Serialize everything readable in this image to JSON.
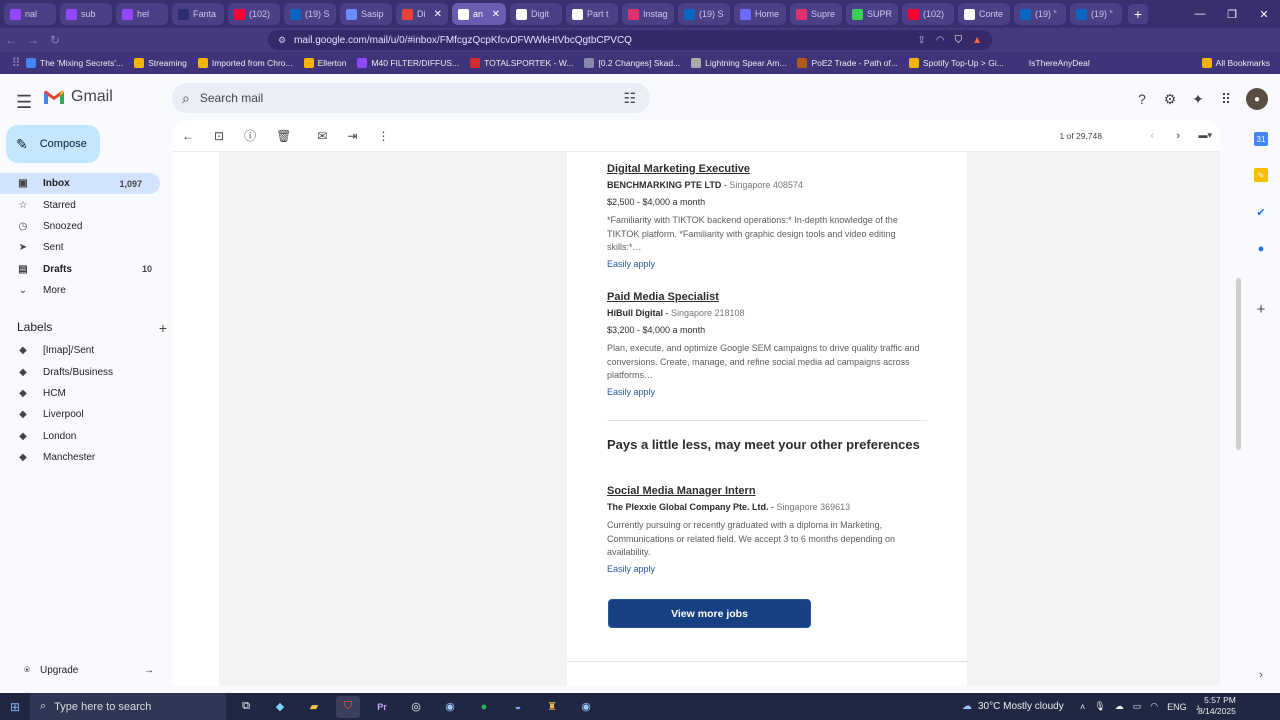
{
  "browser": {
    "tabs": [
      {
        "label": "nal",
        "icon": "twitch-icon",
        "color": "#9146ff"
      },
      {
        "label": "sub",
        "icon": "twitch-icon",
        "color": "#9146ff"
      },
      {
        "label": "hel",
        "icon": "twitch-icon",
        "color": "#9146ff"
      },
      {
        "label": "Fanta",
        "icon": "eye-icon",
        "color": "#2b2b6e"
      },
      {
        "label": "(102)",
        "icon": "youtube-icon",
        "color": "#ff0033"
      },
      {
        "label": "(19) S",
        "icon": "linkedin-icon",
        "color": "#0a66c2"
      },
      {
        "label": "Sasip",
        "icon": "loading-icon",
        "color": "#6a8cff"
      },
      {
        "label": "Di",
        "icon": "gmail-icon",
        "color": "#ea4335"
      },
      {
        "label": "an",
        "icon": "info-icon",
        "color": "#ffffff"
      },
      {
        "label": "Digit",
        "icon": "info-icon",
        "color": "#ffffff"
      },
      {
        "label": "Part t",
        "icon": "info-icon",
        "color": "#ffffff"
      },
      {
        "label": "Instag",
        "icon": "instagram-icon",
        "color": "#e1306c"
      },
      {
        "label": "(19) S",
        "icon": "linkedin-icon",
        "color": "#0a66c2"
      },
      {
        "label": "Home",
        "icon": "doc-icon",
        "color": "#6a6aff"
      },
      {
        "label": "Supre",
        "icon": "instagram-icon",
        "color": "#e1306c"
      },
      {
        "label": "SUPR",
        "icon": "star-icon",
        "color": "#3ccf5a"
      },
      {
        "label": "(102)",
        "icon": "youtube-icon",
        "color": "#ff0033"
      },
      {
        "label": "Conte",
        "icon": "circle-icon",
        "color": "#ffffff"
      },
      {
        "label": "(19) \"",
        "icon": "linkedin-icon",
        "color": "#0a66c2"
      },
      {
        "label": "(19) \"",
        "icon": "linkedin-icon",
        "color": "#0a66c2"
      }
    ],
    "url": "mail.google.com/mail/u/0/#inbox/FMfcgzQcpKfcvDFWWkHtVbcQgtbCPVCQ",
    "bookmarks": [
      {
        "label": "The 'Mixing Secrets'...",
        "color": "#4285f4"
      },
      {
        "label": "Streaming",
        "color": "#f4b400"
      },
      {
        "label": "Imported from Chro...",
        "color": "#f4b400"
      },
      {
        "label": "Ellerton",
        "color": "#f4b400"
      },
      {
        "label": "M40 FILTER/DIFFUS...",
        "color": "#9146ff"
      },
      {
        "label": "TOTALSPORTEK - W...",
        "color": "#d62b2b"
      },
      {
        "label": "[0.2 Changes] Skad...",
        "color": "#8888aa"
      },
      {
        "label": "Lightning Spear Am...",
        "color": "#aaaaaa"
      },
      {
        "label": "PoE2 Trade - Path of...",
        "color": "#b05a1a"
      },
      {
        "label": "Spotify Top-Up > Gi...",
        "color": "#f4b400"
      },
      {
        "label": "IsThereAnyDeal",
        "color": "#3f337a"
      }
    ],
    "all_bookmarks": "All Bookmarks"
  },
  "gmail": {
    "logo_text": "Gmail",
    "search_placeholder": "Search mail",
    "compose": "Compose",
    "nav": [
      {
        "label": "Inbox",
        "count": "1,097",
        "icon": "inbox-icon",
        "selected": true
      },
      {
        "label": "Starred",
        "count": "",
        "icon": "star-icon"
      },
      {
        "label": "Snoozed",
        "count": "",
        "icon": "clock-icon"
      },
      {
        "label": "Sent",
        "count": "",
        "icon": "send-icon"
      },
      {
        "label": "Drafts",
        "count": "10",
        "icon": "draft-icon",
        "bold": true
      },
      {
        "label": "More",
        "count": "",
        "icon": "chevron-down-icon"
      }
    ],
    "labels_title": "Labels",
    "labels": [
      "[Imap]/Sent",
      "Drafts/Business",
      "HCM",
      "Liverpool",
      "London",
      "Manchester"
    ],
    "upgrade": "Upgrade",
    "pagination": "1 of 29,748"
  },
  "email": {
    "jobs_top": [
      {
        "title": "Digital Marketing Executive",
        "company": "BENCHMARKING PTE LTD",
        "location": "Singapore 408574",
        "salary": "$2,500 - $4,000 a month",
        "desc": "*Familiarity with TIKTOK backend operations:* In-depth knowledge of the TIKTOK platform. *Familiarity with graphic design tools and video editing skills:*…",
        "apply": "Easily apply"
      },
      {
        "title": "Paid Media Specialist",
        "company": "HiBull Digital",
        "location": "Singapore 218108",
        "salary": "$3,200 - $4,000 a month",
        "desc": "Plan, execute, and optimize Google SEM campaigns to drive quality traffic and conversions. Create, manage, and refine social media ad campaigns across platforms…",
        "apply": "Easily apply"
      }
    ],
    "section_title": "Pays a little less, may meet your other preferences",
    "job_bottom": {
      "title": "Social Media Manager Intern",
      "company": "The Plexxie Global Company Pte. Ltd.",
      "location": "Singapore 369613",
      "desc": "Currently pursuing or recently graduated with a diploma in Marketing, Communications or related field. We accept 3 to 6 months depending on availability.",
      "apply": "Easily apply"
    },
    "view_more": "View more jobs"
  },
  "taskbar": {
    "search_placeholder": "Type here to search",
    "weather": "30°C  Mostly cloudy",
    "lang": "ENG",
    "time": "5:57 PM",
    "date": "8/14/2025"
  }
}
